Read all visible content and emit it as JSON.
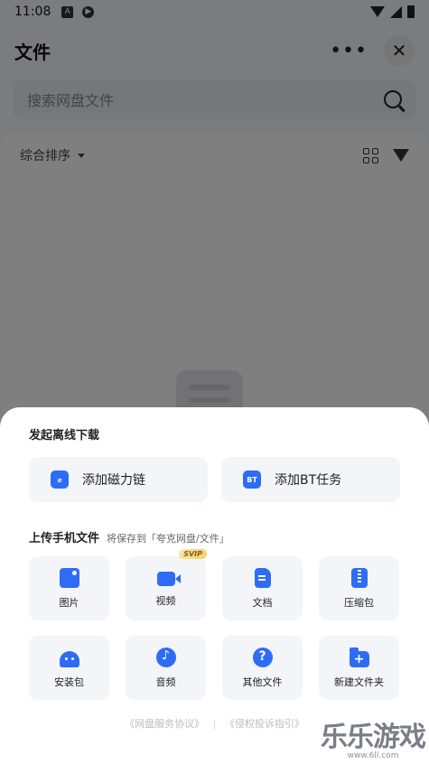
{
  "status_bar": {
    "time": "11:08",
    "icons": [
      "a-icon",
      "p-icon",
      "wifi-icon",
      "signal-icon",
      "battery-icon"
    ]
  },
  "header": {
    "title": "文件",
    "more_icon": "more-icon",
    "close_icon": "close-icon"
  },
  "search": {
    "placeholder": "搜索网盘文件"
  },
  "sort": {
    "label": "综合排序"
  },
  "sheet": {
    "offline_title": "发起离线下载",
    "offline_actions": [
      {
        "label": "添加磁力链",
        "icon": "magnet-icon",
        "glyph": "⌀"
      },
      {
        "label": "添加BT任务",
        "icon": "bt-icon",
        "glyph": "BT"
      }
    ],
    "upload_title": "上传手机文件",
    "upload_hint": "将保存到「夸克网盘/文件」",
    "upload_items": [
      {
        "label": "图片",
        "icon": "image-icon"
      },
      {
        "label": "视频",
        "icon": "video-icon",
        "badge": "SVIP"
      },
      {
        "label": "文档",
        "icon": "document-icon"
      },
      {
        "label": "压缩包",
        "icon": "zip-icon"
      },
      {
        "label": "安装包",
        "icon": "apk-icon"
      },
      {
        "label": "音频",
        "icon": "audio-icon"
      },
      {
        "label": "其他文件",
        "icon": "other-file-icon"
      },
      {
        "label": "新建文件夹",
        "icon": "new-folder-icon"
      }
    ],
    "footer": {
      "service_agreement": "《网盘服务协议》",
      "separator": "|",
      "complaint_guide": "《侵权投诉指引》"
    }
  },
  "watermark": {
    "text": "乐乐游戏",
    "url": "www.6ll.com"
  },
  "colors": {
    "accent": "#2e6cf6",
    "tile_bg": "#f3f5f9",
    "svip_gold": "#f5cf72"
  }
}
